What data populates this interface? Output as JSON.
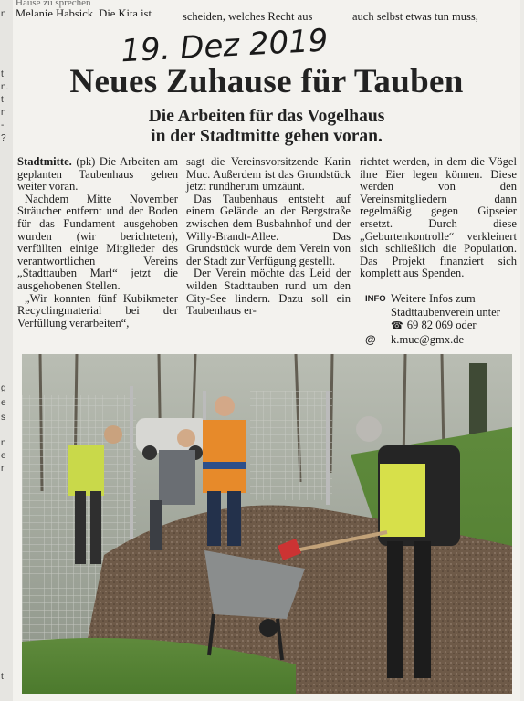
{
  "top_line": {
    "left": "Hause zu sprechen",
    "left2": "Melanie Habsick. Die Kita ist",
    "mid": "scheiden, welches Recht aus",
    "right": "auch selbst etwas tun muss,"
  },
  "left_edge_chars": [
    "n",
    "t",
    "n.",
    "t",
    "n",
    "-",
    "?",
    "g",
    "e",
    "s",
    "n",
    "e",
    "r",
    "t"
  ],
  "handwritten_date": "19. Dez 2019",
  "headline": "Neues Zuhause für Tauben",
  "subheadline": [
    "Die Arbeiten für das Vogelhaus",
    "in der Stadtmitte gehen voran."
  ],
  "columns": [
    {
      "paragraphs": [
        {
          "lead": "Stadtmitte.",
          "text": " (pk) Die Arbeiten am geplanten Taubenhaus gehen weiter voran."
        },
        {
          "text": "Nachdem Mitte November Sträucher entfernt und der Boden für das Fundament ausgehoben wurden (wir berichteten), verfüllten einige Mitglieder des verantwortlichen Vereins „Stadttauben Marl“ jetzt die ausgehobenen Stellen."
        },
        {
          "text": "„Wir konnten fünf Kubikmeter Recyclingmaterial bei der Verfüllung verarbeiten“,"
        }
      ]
    },
    {
      "paragraphs": [
        {
          "text": "sagt die Vereinsvorsitzende Karin Muc. Außerdem ist das Grundstück jetzt rundherum umzäunt."
        },
        {
          "text": "Das Taubenhaus entsteht auf einem Gelände an der Bergstraße zwischen dem Busbahnhof und der Willy-Brandt-Allee. Das Grundstück wurde dem Verein von der Stadt zur Verfügung gestellt."
        },
        {
          "text": "Der Verein möchte das Leid der wilden Stadttauben rund um den City-See lindern. Dazu soll ein Taubenhaus er-"
        }
      ]
    },
    {
      "paragraphs": [
        {
          "text": "richtet werden, in dem die Vögel ihre Eier legen können. Diese werden von den Vereinsmitgliedern dann regelmäßig gegen Gipseier ersetzt. Durch diese „Geburtenkontrolle“ verkleinert sich schließlich die Population. Das Projekt finanziert sich komplett aus Spenden."
        }
      ]
    }
  ],
  "info_box": {
    "tag": "INFO",
    "text": "Weitere Infos zum Stadttaubenverein unter",
    "phone_icon": "phone-icon",
    "phone": "69 82 069 oder",
    "at_icon": "@",
    "email": "k.muc@gmx.de"
  },
  "photo": {
    "alt_icon": "photo-workers-shoveling"
  }
}
